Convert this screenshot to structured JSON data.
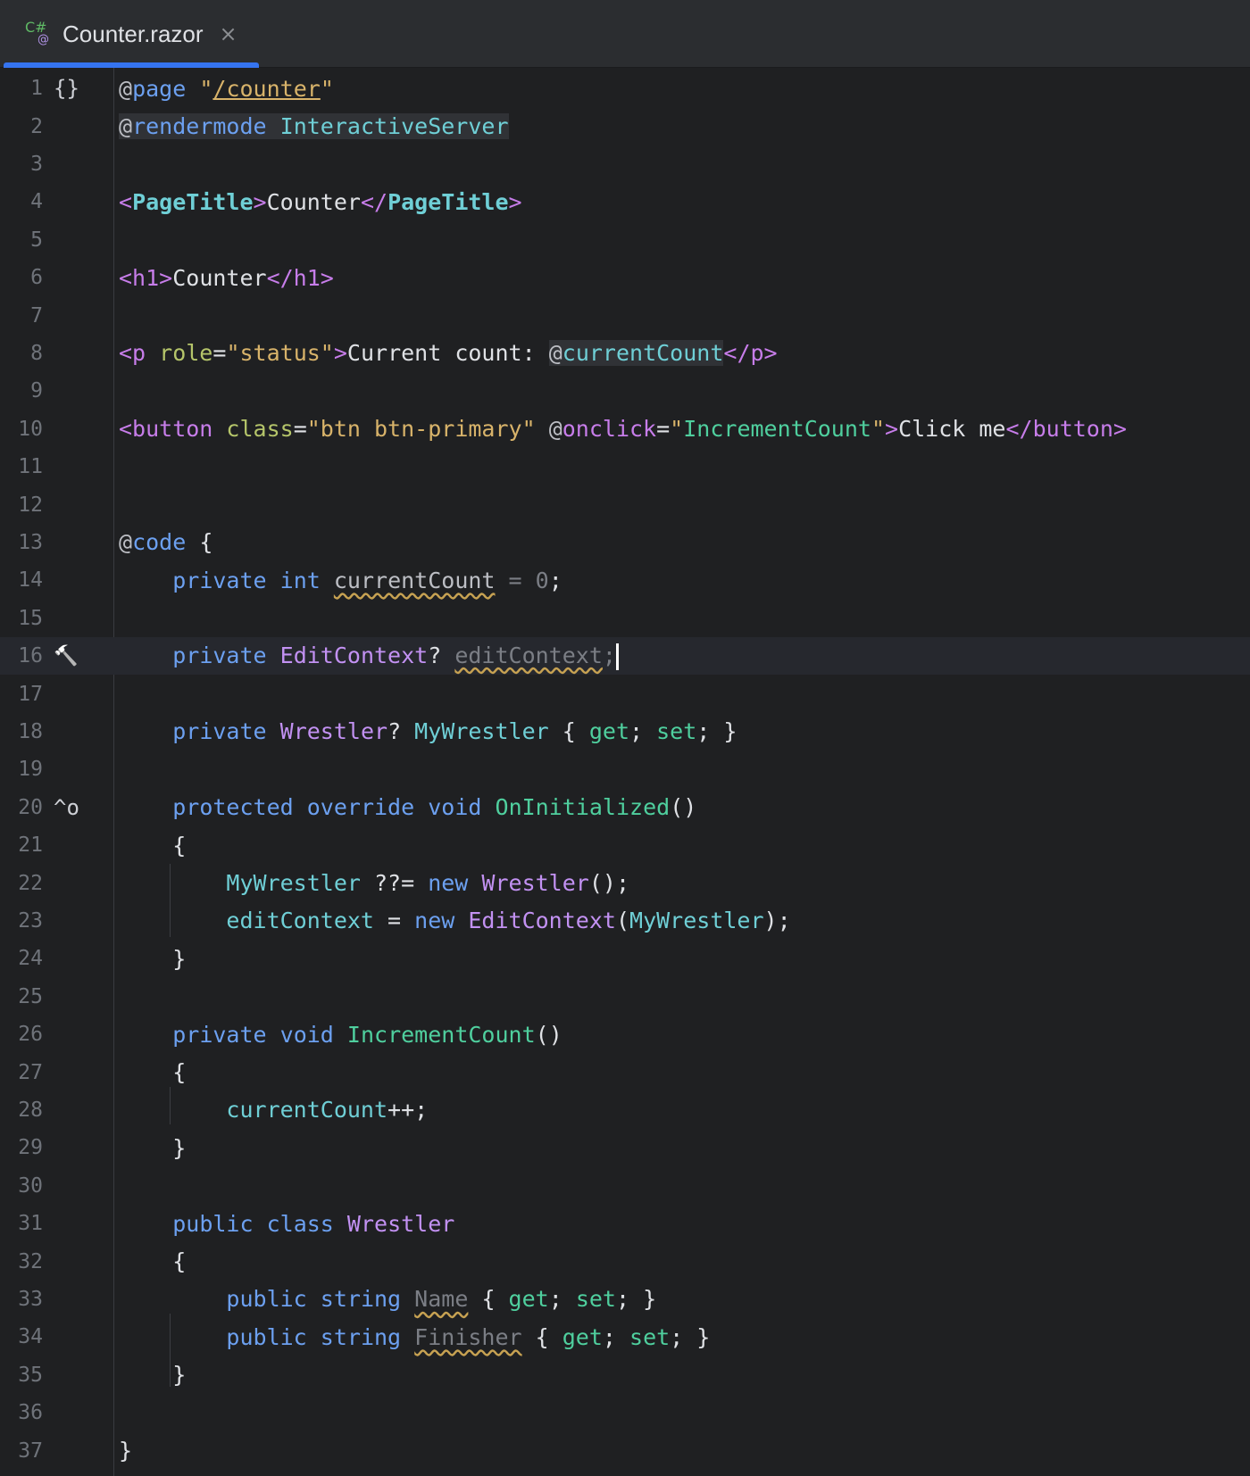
{
  "tab": {
    "title": "Counter.razor",
    "icon": "csharp-razor-file-icon",
    "close_symbol": "×"
  },
  "lines": [
    {
      "n": "1",
      "segs": [
        [
          "at",
          "@"
        ],
        [
          "dir",
          "page"
        ],
        [
          "txt",
          " "
        ],
        [
          "str",
          "\""
        ],
        [
          "strlink",
          "/counter"
        ],
        [
          "str",
          "\""
        ]
      ]
    },
    {
      "n": "2",
      "segs": [
        [
          "at",
          "@"
        ],
        [
          "dir",
          "rendermode"
        ],
        [
          "txt",
          " "
        ],
        [
          "prop",
          "InteractiveServer"
        ]
      ]
    },
    {
      "n": "3",
      "segs": []
    },
    {
      "n": "4",
      "segs": [
        [
          "tag",
          "<"
        ],
        [
          "tagname",
          "PageTitle"
        ],
        [
          "tag",
          ">"
        ],
        [
          "txt",
          "Counter"
        ],
        [
          "tag",
          "</"
        ],
        [
          "tagname",
          "PageTitle"
        ],
        [
          "tag",
          ">"
        ]
      ]
    },
    {
      "n": "5",
      "segs": []
    },
    {
      "n": "6",
      "segs": [
        [
          "tag",
          "<h1>"
        ],
        [
          "txt",
          "Counter"
        ],
        [
          "tag",
          "</h1>"
        ]
      ]
    },
    {
      "n": "7",
      "segs": []
    },
    {
      "n": "8",
      "segs": [
        [
          "tag",
          "<p "
        ],
        [
          "attr",
          "role"
        ],
        [
          "txt",
          "="
        ],
        [
          "str",
          "\"status\""
        ],
        [
          "tag",
          ">"
        ],
        [
          "txt",
          "Current count: "
        ],
        [
          "at",
          "@"
        ],
        [
          "prop",
          "currentCount"
        ],
        [
          "tag",
          "</p>"
        ]
      ]
    },
    {
      "n": "9",
      "segs": []
    },
    {
      "n": "10",
      "segs": [
        [
          "tag",
          "<button "
        ],
        [
          "attr",
          "class"
        ],
        [
          "txt",
          "="
        ],
        [
          "str",
          "\"btn btn-primary\""
        ],
        [
          "txt",
          " "
        ],
        [
          "at",
          "@"
        ],
        [
          "tag",
          "onclick"
        ],
        [
          "txt",
          "="
        ],
        [
          "str",
          "\""
        ],
        [
          "method",
          "IncrementCount"
        ],
        [
          "str",
          "\""
        ],
        [
          "tag",
          ">"
        ],
        [
          "txt",
          "Click me"
        ],
        [
          "tag",
          "</button>"
        ]
      ]
    },
    {
      "n": "11",
      "segs": []
    },
    {
      "n": "12",
      "segs": []
    },
    {
      "n": "13",
      "segs": [
        [
          "at",
          "@"
        ],
        [
          "dir",
          "code"
        ],
        [
          "txt",
          " {"
        ]
      ]
    },
    {
      "n": "14",
      "segs": [
        [
          "txt",
          "    "
        ],
        [
          "kw",
          "private"
        ],
        [
          "txt",
          " "
        ],
        [
          "kw",
          "int"
        ],
        [
          "txt",
          " "
        ],
        [
          "warn",
          "currentCount"
        ],
        [
          "dim",
          " = 0"
        ],
        [
          "txt",
          ";"
        ]
      ]
    },
    {
      "n": "15",
      "segs": []
    },
    {
      "n": "16",
      "segs": [
        [
          "txt",
          "    "
        ],
        [
          "kw",
          "private"
        ],
        [
          "txt",
          " "
        ],
        [
          "type",
          "EditContext"
        ],
        [
          "txt",
          "? "
        ],
        [
          "warn-dim",
          "editContext"
        ],
        [
          "dim",
          ";"
        ]
      ]
    },
    {
      "n": "17",
      "segs": []
    },
    {
      "n": "18",
      "segs": [
        [
          "txt",
          "    "
        ],
        [
          "kw",
          "private"
        ],
        [
          "txt",
          " "
        ],
        [
          "type",
          "Wrestler"
        ],
        [
          "txt",
          "? "
        ],
        [
          "prop",
          "MyWrestler"
        ],
        [
          "txt",
          " { "
        ],
        [
          "acc",
          "get"
        ],
        [
          "txt",
          "; "
        ],
        [
          "acc",
          "set"
        ],
        [
          "txt",
          "; }"
        ]
      ]
    },
    {
      "n": "19",
      "segs": []
    },
    {
      "n": "20",
      "segs": [
        [
          "txt",
          "    "
        ],
        [
          "kw",
          "protected"
        ],
        [
          "txt",
          " "
        ],
        [
          "kw",
          "override"
        ],
        [
          "txt",
          " "
        ],
        [
          "kw",
          "void"
        ],
        [
          "txt",
          " "
        ],
        [
          "method",
          "OnInitialized"
        ],
        [
          "txt",
          "()"
        ]
      ]
    },
    {
      "n": "21",
      "segs": [
        [
          "txt",
          "    {"
        ]
      ]
    },
    {
      "n": "22",
      "segs": [
        [
          "txt",
          "        "
        ],
        [
          "prop",
          "MyWrestler"
        ],
        [
          "txt",
          " ??= "
        ],
        [
          "kw",
          "new"
        ],
        [
          "txt",
          " "
        ],
        [
          "type",
          "Wrestler"
        ],
        [
          "txt",
          "();"
        ]
      ]
    },
    {
      "n": "23",
      "segs": [
        [
          "txt",
          "        "
        ],
        [
          "prop",
          "editContext"
        ],
        [
          "txt",
          " = "
        ],
        [
          "kw",
          "new"
        ],
        [
          "txt",
          " "
        ],
        [
          "type",
          "EditContext"
        ],
        [
          "txt",
          "("
        ],
        [
          "prop",
          "MyWrestler"
        ],
        [
          "txt",
          ");"
        ]
      ]
    },
    {
      "n": "24",
      "segs": [
        [
          "txt",
          "    }"
        ]
      ]
    },
    {
      "n": "25",
      "segs": []
    },
    {
      "n": "26",
      "segs": [
        [
          "txt",
          "    "
        ],
        [
          "kw",
          "private"
        ],
        [
          "txt",
          " "
        ],
        [
          "kw",
          "void"
        ],
        [
          "txt",
          " "
        ],
        [
          "method",
          "IncrementCount"
        ],
        [
          "txt",
          "()"
        ]
      ]
    },
    {
      "n": "27",
      "segs": [
        [
          "txt",
          "    {"
        ]
      ]
    },
    {
      "n": "28",
      "segs": [
        [
          "txt",
          "        "
        ],
        [
          "prop",
          "currentCount"
        ],
        [
          "txt",
          "++;"
        ]
      ]
    },
    {
      "n": "29",
      "segs": [
        [
          "txt",
          "    }"
        ]
      ]
    },
    {
      "n": "30",
      "segs": []
    },
    {
      "n": "31",
      "segs": [
        [
          "txt",
          "    "
        ],
        [
          "kw",
          "public"
        ],
        [
          "txt",
          " "
        ],
        [
          "kw",
          "class"
        ],
        [
          "txt",
          " "
        ],
        [
          "type",
          "Wrestler"
        ]
      ]
    },
    {
      "n": "32",
      "segs": [
        [
          "txt",
          "    {"
        ]
      ]
    },
    {
      "n": "33",
      "segs": [
        [
          "txt",
          "        "
        ],
        [
          "kw",
          "public"
        ],
        [
          "txt",
          " "
        ],
        [
          "kw",
          "string"
        ],
        [
          "txt",
          " "
        ],
        [
          "warn-dim",
          "Name"
        ],
        [
          "txt",
          " { "
        ],
        [
          "acc",
          "get"
        ],
        [
          "txt",
          "; "
        ],
        [
          "acc",
          "set"
        ],
        [
          "txt",
          "; }"
        ]
      ]
    },
    {
      "n": "34",
      "segs": [
        [
          "txt",
          "        "
        ],
        [
          "kw",
          "public"
        ],
        [
          "txt",
          " "
        ],
        [
          "kw",
          "string"
        ],
        [
          "txt",
          " "
        ],
        [
          "warn-dim",
          "Finisher"
        ],
        [
          "txt",
          " { "
        ],
        [
          "acc",
          "get"
        ],
        [
          "txt",
          "; "
        ],
        [
          "acc",
          "set"
        ],
        [
          "txt",
          "; }"
        ]
      ]
    },
    {
      "n": "35",
      "segs": [
        [
          "txt",
          "    }"
        ]
      ]
    },
    {
      "n": "36",
      "segs": []
    },
    {
      "n": "37",
      "segs": [
        [
          "txt",
          "}"
        ]
      ]
    }
  ],
  "gutter_icons": [
    {
      "line": 1,
      "name": "braces-icon",
      "glyph": "{}"
    },
    {
      "line": 16,
      "name": "hammer-icon",
      "glyph": "🔨"
    },
    {
      "line": 20,
      "name": "override-icon",
      "glyph": "^o"
    }
  ],
  "current_line": 16,
  "colors": {
    "accent": "#3574f0",
    "background": "#1f2022"
  }
}
